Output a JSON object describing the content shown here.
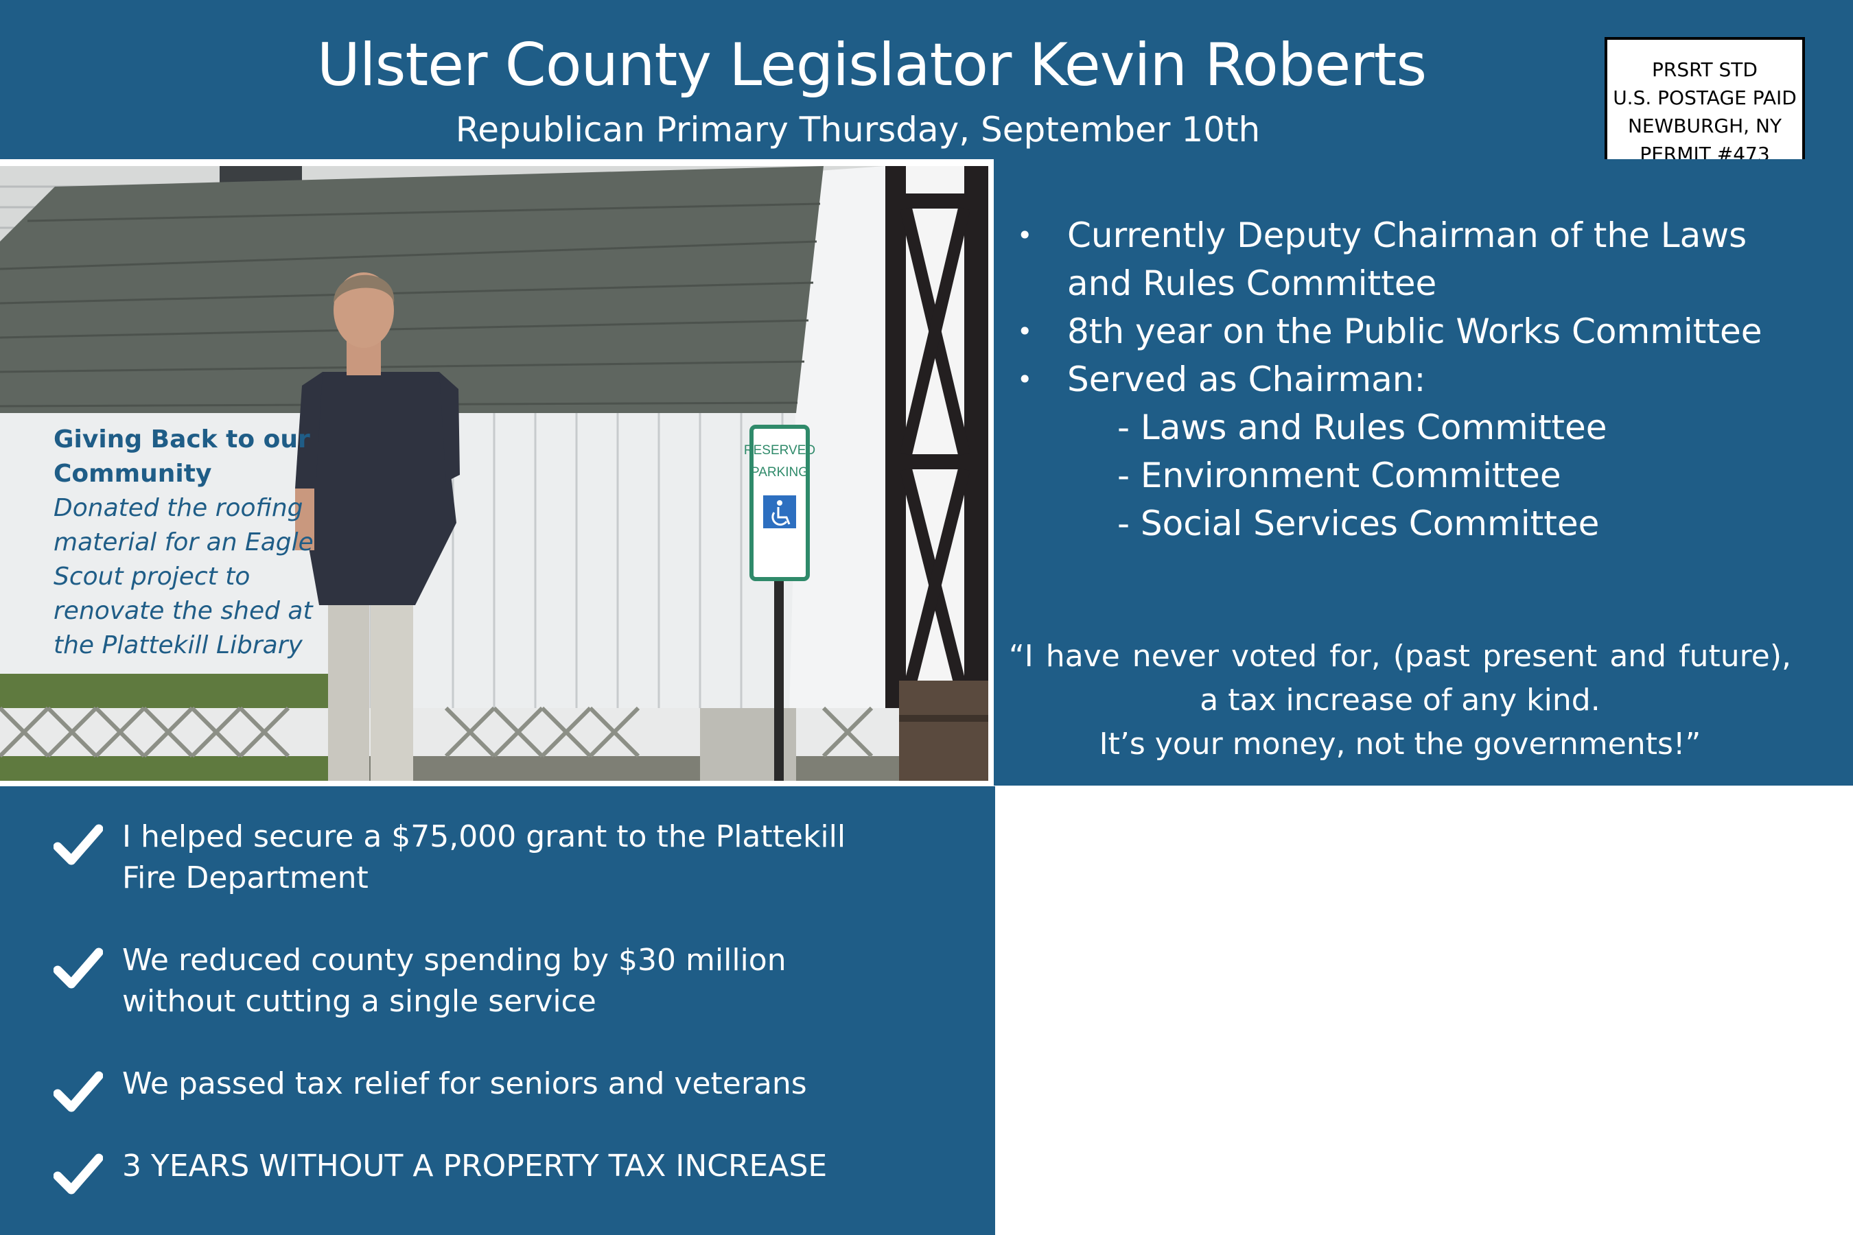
{
  "header": {
    "title": "Ulster County Legislator Kevin Roberts",
    "subtitle": "Republican Primary Thursday, September 10th"
  },
  "postage": {
    "line1": "PRSRT STD",
    "line2": "U.S. POSTAGE PAID",
    "line3": "NEWBURGH, NY",
    "line4": "PERMIT #473"
  },
  "photo": {
    "sign_line1": "RESERVED",
    "sign_line2": "PARKING",
    "caption_heading": "Giving Back to our Community",
    "caption_body": "Donated the roofing material for an Eagle Scout project to renovate the shed at the Plattekill Library"
  },
  "qualifications": {
    "items": [
      "Currently Deputy Chairman of the Laws and Rules Committee",
      "8th year on the Public Works Committee",
      "Served as Chairman:"
    ],
    "sub_items": [
      "- Laws and Rules Committee",
      "- Environment Committee",
      "- Social Services Committee"
    ]
  },
  "quote": {
    "line1": "“I have never voted for, (past present and future), a tax increase of any kind.",
    "line2": "It’s your money, not the governments!”"
  },
  "accomplishments": [
    "I helped secure a $75,000 grant to the Plattekill Fire Department",
    "We reduced county spending by $30 million without cutting a single service",
    "We passed tax relief for seniors and veterans",
    "3 YEARS WITHOUT A PROPERTY TAX INCREASE"
  ],
  "colors": {
    "primary_blue": "#1f5d87",
    "text_white": "#ffffff",
    "caption_blue": "#1f5d87"
  }
}
